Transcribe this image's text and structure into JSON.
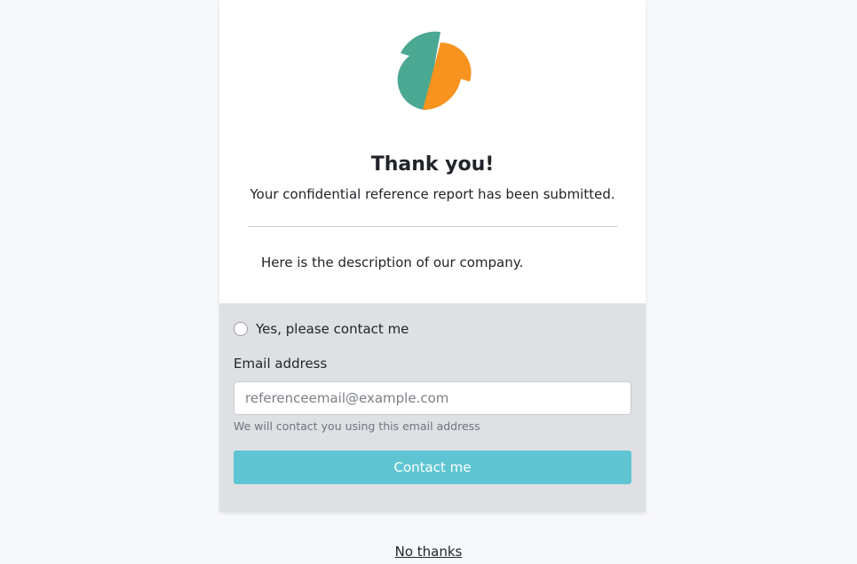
{
  "logo": {
    "icon": "company-logo-icon",
    "colors": {
      "left": "#4aa893",
      "right": "#f7931e"
    }
  },
  "confirmation": {
    "title": "Thank you!",
    "message": "Your confidential reference report has been submitted."
  },
  "company": {
    "description": "Here is the description of our company."
  },
  "contact": {
    "radio_label": "Yes, please contact me",
    "radio_selected": false,
    "email_label": "Email address",
    "email_placeholder": "referenceemail@example.com",
    "email_value": "",
    "email_help": "We will contact you using this email address",
    "button_label": "Contact me",
    "button_color": "#5fc5d2"
  },
  "footer": {
    "no_thanks_label": "No thanks"
  }
}
